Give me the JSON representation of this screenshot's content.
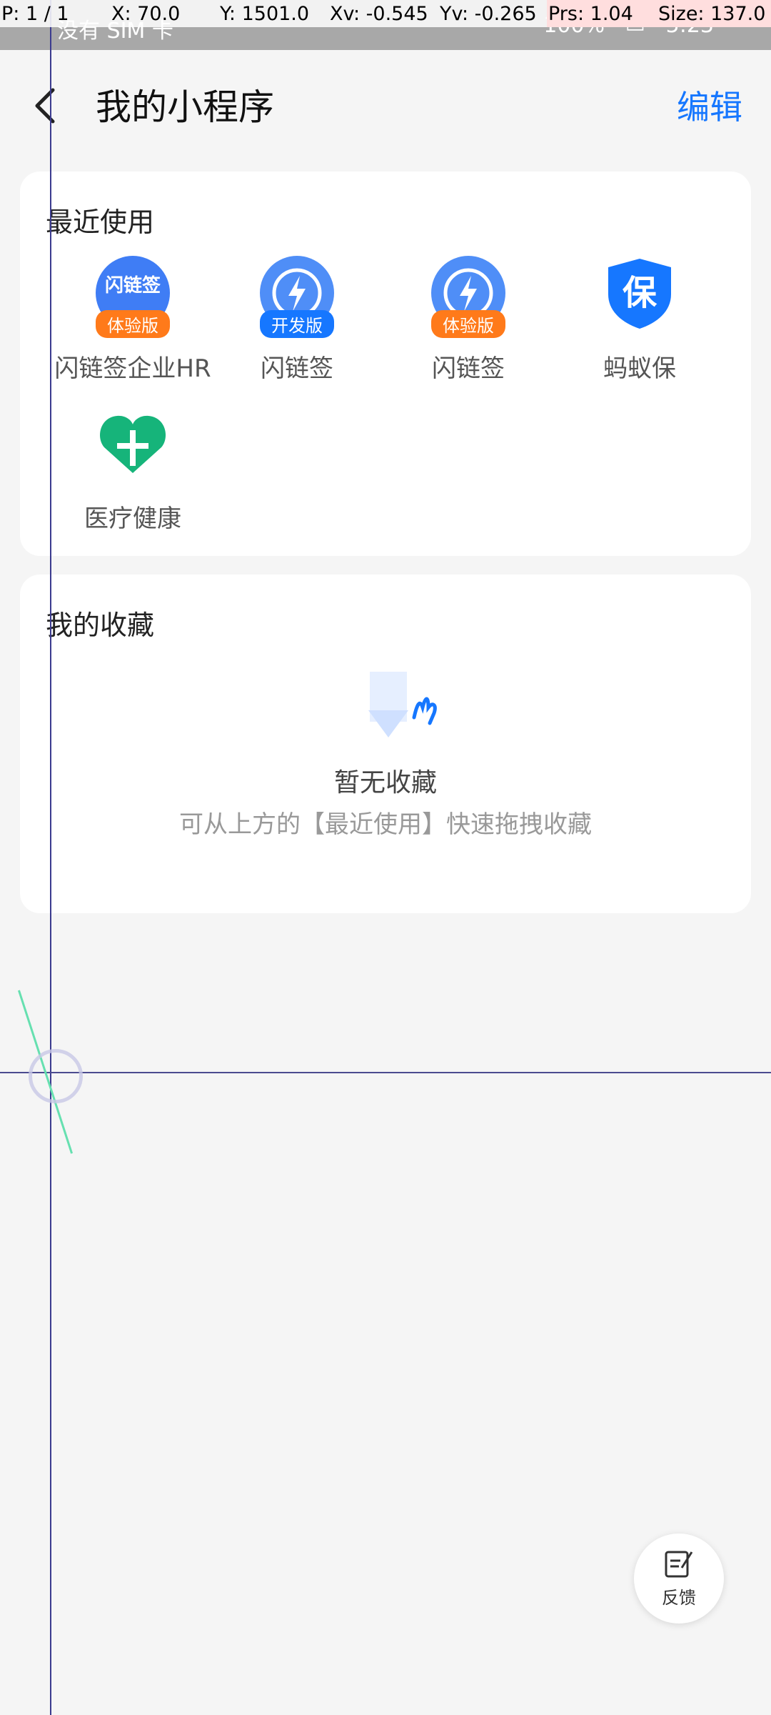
{
  "debug": {
    "p": "P: 1 / 1",
    "x": "X: 70.0",
    "y": "Y: 1501.0",
    "xv": "Xv: -0.545",
    "yv": "Yv: -0.265",
    "prs": "Prs: 1.04",
    "size": "Size: 137.0"
  },
  "status_bar": {
    "carrier": "没有 SIM 卡",
    "battery": "100%",
    "time": "5:23"
  },
  "header": {
    "title": "我的小程序",
    "edit_label": "编辑"
  },
  "recent": {
    "title": "最近使用",
    "apps": [
      {
        "label": "闪链签企业HR",
        "badge": "体验版",
        "icon": "shanlianqian-hr-icon"
      },
      {
        "label": "闪链签",
        "badge": "开发版",
        "icon": "lightning-icon"
      },
      {
        "label": "闪链签",
        "badge": "体验版",
        "icon": "lightning-icon"
      },
      {
        "label": "蚂蚁保",
        "badge": "",
        "icon": "shield-bao-icon",
        "glyph": "保"
      },
      {
        "label": "医疗健康",
        "badge": "",
        "icon": "heart-icon"
      }
    ],
    "icon_text_hr": "闪链签"
  },
  "favorites": {
    "title": "我的收藏",
    "empty_title": "暂无收藏",
    "empty_desc": "可从上方的【最近使用】快速拖拽收藏"
  },
  "feedback": {
    "label": "反馈"
  },
  "colors": {
    "accent": "#1677ff",
    "badge_orange": "#ff7a1a",
    "health_green": "#16b47a"
  }
}
